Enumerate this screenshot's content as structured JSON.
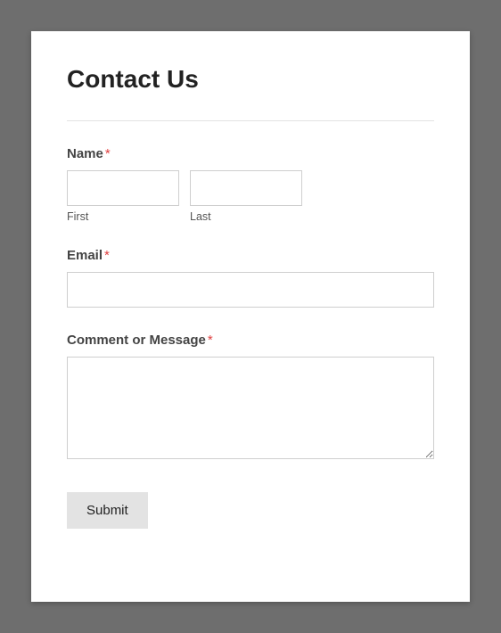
{
  "title": "Contact Us",
  "required_marker": "*",
  "fields": {
    "name": {
      "label": "Name",
      "first": {
        "sublabel": "First",
        "value": ""
      },
      "last": {
        "sublabel": "Last",
        "value": ""
      }
    },
    "email": {
      "label": "Email",
      "value": ""
    },
    "message": {
      "label": "Comment or Message",
      "value": ""
    }
  },
  "submit_label": "Submit"
}
